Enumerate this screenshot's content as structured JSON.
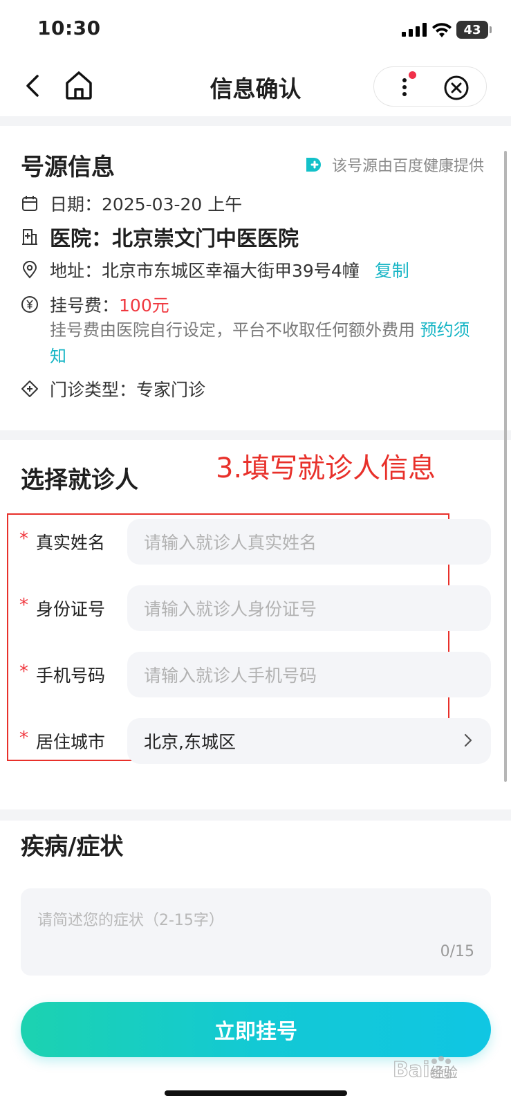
{
  "status_bar": {
    "time": "10:30",
    "battery": "43"
  },
  "nav": {
    "title": "信息确认"
  },
  "source_info": {
    "title": "号源信息",
    "provider": "该号源由百度健康提供",
    "date_label": "日期：",
    "date_value": "2025-03-20 上午",
    "hospital_label": "医院：",
    "hospital_value": "北京崇文门中医医院",
    "address_label": "地址：",
    "address_value": "北京市东城区幸福大街甲39号4幢",
    "copy_link": "复制",
    "fee_label": "挂号费：",
    "fee_value": "100元",
    "fee_note": "挂号费由医院自行设定，平台不收取任何额外费用",
    "notice_link": "预约须知",
    "clinic_type_label": "门诊类型：",
    "clinic_type_value": "专家门诊"
  },
  "patient": {
    "title": "选择就诊人",
    "annotation": "3.填写就诊人信息",
    "required_mark": "*",
    "fields": [
      {
        "label": "真实姓名",
        "placeholder": "请输入就诊人真实姓名"
      },
      {
        "label": "身份证号",
        "placeholder": "请输入就诊人身份证号"
      },
      {
        "label": "手机号码",
        "placeholder": "请输入就诊人手机号码"
      },
      {
        "label": "居住城市",
        "value": "北京,东城区"
      }
    ]
  },
  "symptoms": {
    "title": "疾病/症状",
    "placeholder": "请简述您的症状（2-15字）",
    "counter": "0/15"
  },
  "submit_label": "立即挂号",
  "watermark_text": "经验"
}
